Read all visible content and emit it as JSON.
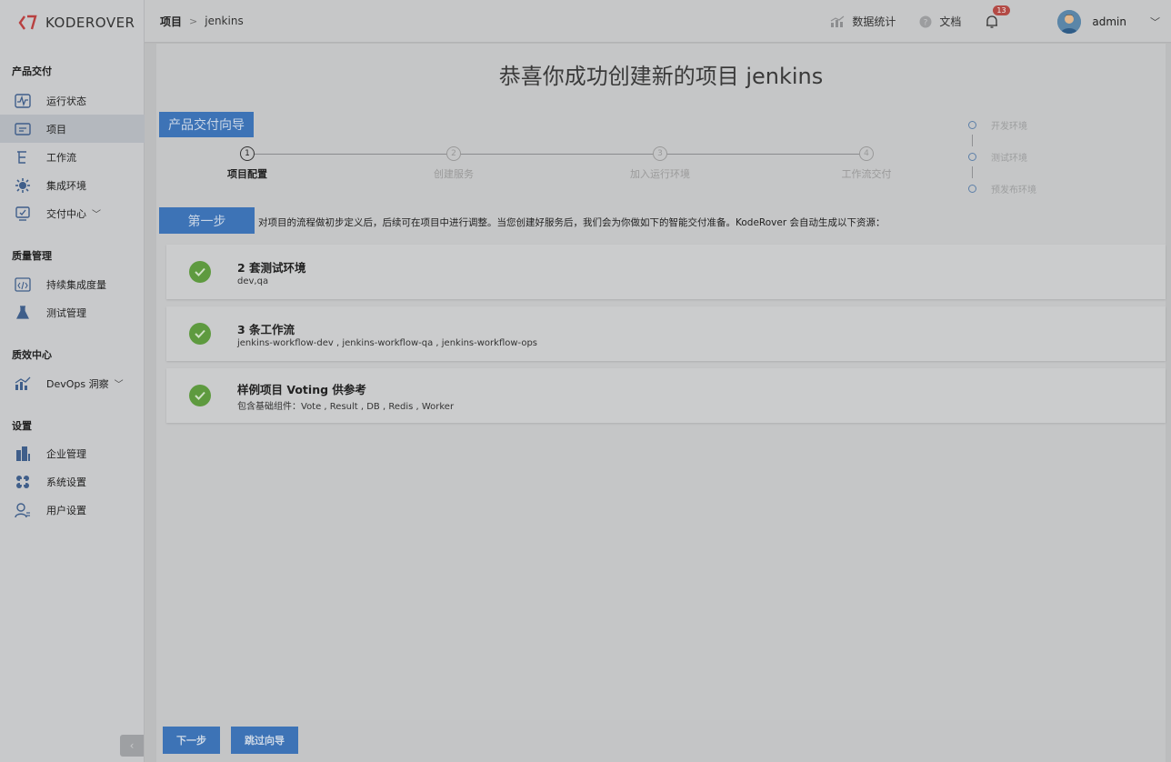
{
  "app": {
    "logo_text": "KODEROVER"
  },
  "sidebar": {
    "groups": [
      {
        "title": "产品交付"
      },
      {
        "title": "质量管理"
      },
      {
        "title": "质效中心"
      },
      {
        "title": "设置"
      }
    ],
    "items": [
      {
        "label": "运行状态",
        "icon": "pulse-icon"
      },
      {
        "label": "项目",
        "icon": "folder-icon"
      },
      {
        "label": "工作流",
        "icon": "workflow-icon"
      },
      {
        "label": "集成环境",
        "icon": "environment-icon"
      },
      {
        "label": "交付中心",
        "icon": "delivery-icon"
      },
      {
        "label": "持续集成度量",
        "icon": "code-icon"
      },
      {
        "label": "测试管理",
        "icon": "flask-icon"
      },
      {
        "label": "DevOps 洞察",
        "icon": "chart-icon"
      },
      {
        "label": "企业管理",
        "icon": "building-icon"
      },
      {
        "label": "系统设置",
        "icon": "settings-icon"
      },
      {
        "label": "用户设置",
        "icon": "user-icon"
      }
    ],
    "collapse_glyph": "‹"
  },
  "header": {
    "breadcrumb_root": "项目",
    "breadcrumb_sep": ">",
    "breadcrumb_current": "jenkins",
    "stats_label": "数据统计",
    "docs_label": "文档",
    "notification_count": "13",
    "username": "admin"
  },
  "main": {
    "heading": "恭喜你成功创建新的项目 jenkins",
    "guide_tag": "产品交付向导",
    "steps": [
      {
        "num": "1",
        "label": "项目配置",
        "active": true
      },
      {
        "num": "2",
        "label": "创建服务",
        "active": false
      },
      {
        "num": "3",
        "label": "加入运行环境",
        "active": false
      },
      {
        "num": "4",
        "label": "工作流交付",
        "active": false
      }
    ],
    "environments": [
      "开发环境",
      "测试环境",
      "预发布环境"
    ],
    "step_button": "第一步",
    "step_description": "对项目的流程做初步定义后，后续可在项目中进行调整。当您创建好服务后，我们会为你做如下的智能交付准备。KodeRover 会自动生成以下资源：",
    "cards": [
      {
        "title": "2 套测试环境",
        "subtitle": "dev,qa"
      },
      {
        "title": "3 条工作流",
        "subtitle": "jenkins-workflow-dev , jenkins-workflow-qa , jenkins-workflow-ops"
      },
      {
        "title": "样例项目 Voting 供参考",
        "subtitle": "包含基础组件：Vote , Result , DB , Redis , Worker"
      }
    ]
  },
  "footer": {
    "next_label": "下一步",
    "skip_label": "跳过向导"
  }
}
